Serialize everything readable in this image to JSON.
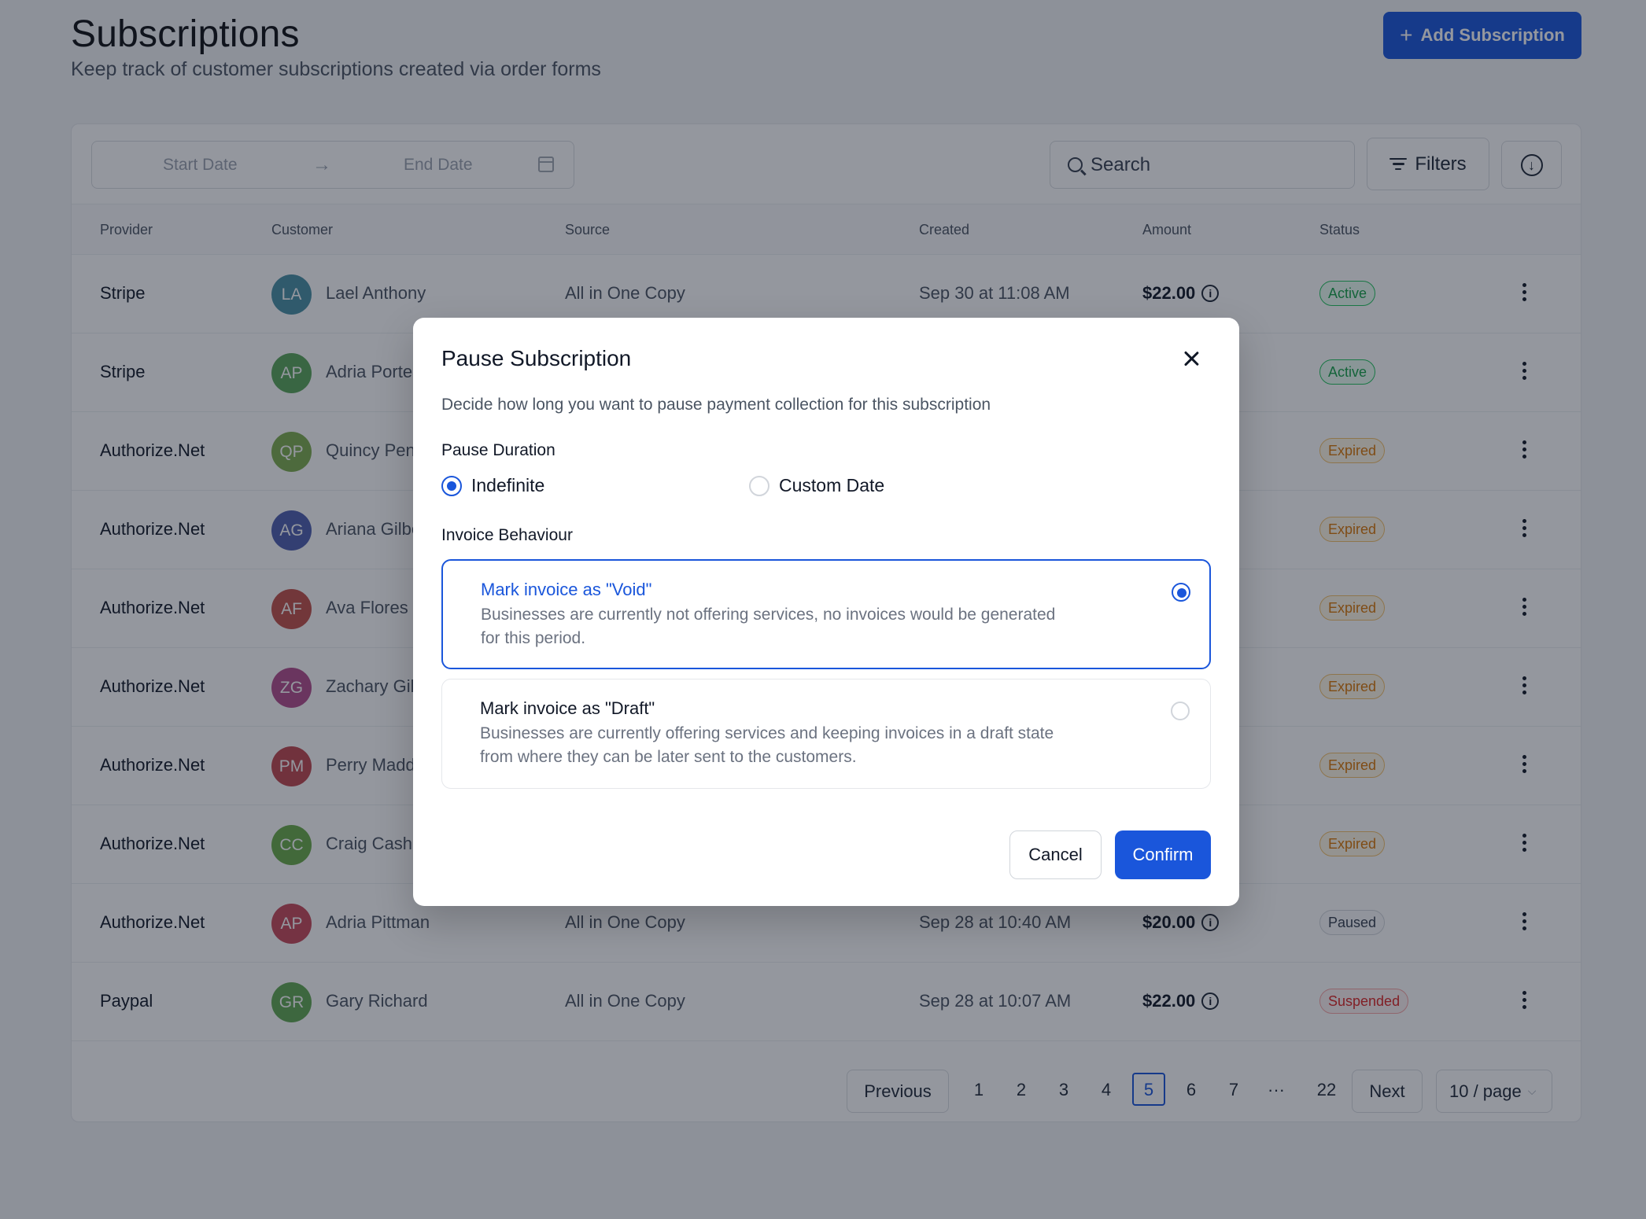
{
  "header": {
    "title": "Subscriptions",
    "subtitle": "Keep track of customer subscriptions created via order forms",
    "add_button": "Add Subscription"
  },
  "toolbar": {
    "start_date_placeholder": "Start Date",
    "end_date_placeholder": "End Date",
    "search_placeholder": "Search",
    "filters_label": "Filters"
  },
  "table": {
    "columns": [
      "Provider",
      "Customer",
      "Source",
      "Created",
      "Amount",
      "Status"
    ],
    "rows": [
      {
        "provider": "Stripe",
        "initials": "LA",
        "avatar_color": "#4a90a4",
        "customer": "Lael Anthony",
        "source": "All in One Copy",
        "created": "Sep 30 at 11:08 AM",
        "amount": "$22.00",
        "status": "Active",
        "status_kind": "active"
      },
      {
        "provider": "Stripe",
        "initials": "AP",
        "avatar_color": "#5aa65a",
        "customer": "Adria Porter",
        "source": "",
        "created": "",
        "amount": "",
        "status": "Active",
        "status_kind": "active"
      },
      {
        "provider": "Authorize.Net",
        "initials": "QP",
        "avatar_color": "#7fad4f",
        "customer": "Quincy Pen",
        "source": "",
        "created": "",
        "amount": "",
        "status": "Expired",
        "status_kind": "expired"
      },
      {
        "provider": "Authorize.Net",
        "initials": "AG",
        "avatar_color": "#4f5fb0",
        "customer": "Ariana Gilbe",
        "source": "",
        "created": "",
        "amount": "",
        "status": "Expired",
        "status_kind": "expired"
      },
      {
        "provider": "Authorize.Net",
        "initials": "AF",
        "avatar_color": "#c2504a",
        "customer": "Ava Flores",
        "source": "",
        "created": "",
        "amount": "",
        "status": "Expired",
        "status_kind": "expired"
      },
      {
        "provider": "Authorize.Net",
        "initials": "ZG",
        "avatar_color": "#b34e8c",
        "customer": "Zachary Gil",
        "source": "",
        "created": "",
        "amount": "",
        "status": "Expired",
        "status_kind": "expired"
      },
      {
        "provider": "Authorize.Net",
        "initials": "PM",
        "avatar_color": "#c0474f",
        "customer": "Perry Madd",
        "source": "",
        "created": "",
        "amount": "",
        "status": "Expired",
        "status_kind": "expired"
      },
      {
        "provider": "Authorize.Net",
        "initials": "CC",
        "avatar_color": "#6aab4a",
        "customer": "Craig Cash",
        "source": "",
        "created": "",
        "amount": "",
        "status": "Expired",
        "status_kind": "expired"
      },
      {
        "provider": "Authorize.Net",
        "initials": "AP",
        "avatar_color": "#c74a5a",
        "customer": "Adria Pittman",
        "source": "All in One Copy",
        "created": "Sep 28 at 10:40 AM",
        "amount": "$20.00",
        "status": "Paused",
        "status_kind": "paused"
      },
      {
        "provider": "Paypal",
        "initials": "GR",
        "avatar_color": "#62a852",
        "customer": "Gary Richard",
        "source": "All in One Copy",
        "created": "Sep 28 at 10:07 AM",
        "amount": "$22.00",
        "status": "Suspended",
        "status_kind": "suspended"
      }
    ]
  },
  "pagination": {
    "previous": "Previous",
    "next": "Next",
    "pages": [
      "1",
      "2",
      "3",
      "4",
      "5",
      "6",
      "7",
      "···",
      "22"
    ],
    "current": "5",
    "page_size": "10 / page"
  },
  "modal": {
    "title": "Pause Subscription",
    "description": "Decide how long you want to pause payment collection for this subscription",
    "duration_label": "Pause Duration",
    "duration_options": [
      "Indefinite",
      "Custom Date"
    ],
    "duration_selected": "Indefinite",
    "invoice_label": "Invoice Behaviour",
    "invoice_options": [
      {
        "title": "Mark invoice as \"Void\"",
        "desc": "Businesses are currently not offering services, no invoices would be generated for this period.",
        "selected": true
      },
      {
        "title": "Mark invoice as \"Draft\"",
        "desc": "Businesses are currently offering services and keeping invoices in a draft state from where they can be later sent to the customers.",
        "selected": false
      }
    ],
    "cancel": "Cancel",
    "confirm": "Confirm"
  },
  "colors": {
    "accent": "#1a56db"
  }
}
